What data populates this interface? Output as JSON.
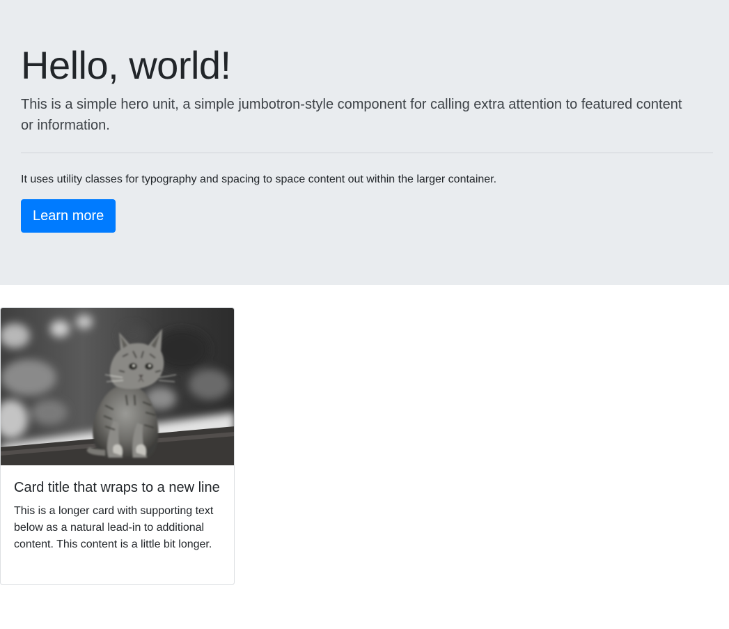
{
  "hero": {
    "title": "Hello, world!",
    "lead": "This is a simple hero unit, a simple jumbotron-style component for calling extra attention to featured content or information.",
    "body": "It uses utility classes for typography and spacing to space content out within the larger container.",
    "button_label": "Learn more"
  },
  "card": {
    "image_icon": "kitten-photo",
    "title": "Card title that wraps to a new line",
    "text": "This is a longer card with supporting text below as a natural lead-in to additional content. This content is a little bit longer."
  },
  "colors": {
    "hero_background": "#e9ecef",
    "primary": "#007bff",
    "text": "#212529"
  }
}
